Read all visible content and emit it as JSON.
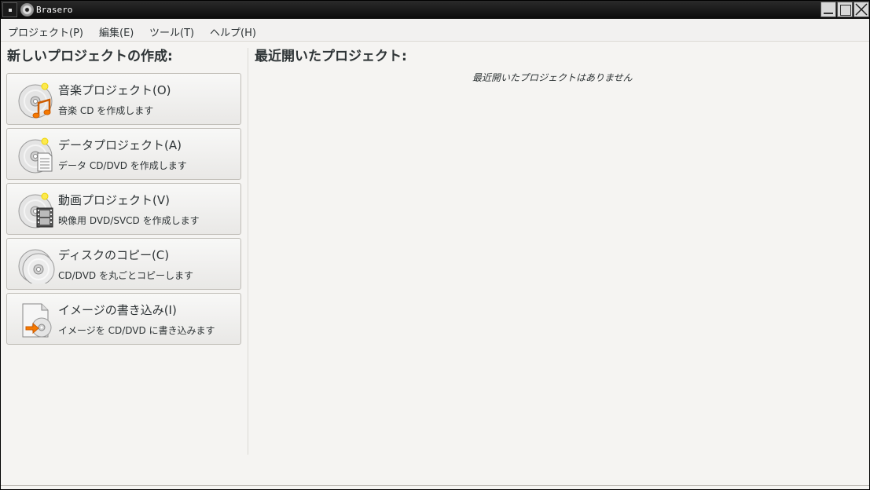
{
  "window": {
    "title": "Brasero"
  },
  "menubar": {
    "items": [
      {
        "label": "プロジェクト(P)"
      },
      {
        "label": "編集(E)"
      },
      {
        "label": "ツール(T)"
      },
      {
        "label": "ヘルプ(H)"
      }
    ]
  },
  "new_project": {
    "title": "新しいプロジェクトの作成:",
    "buttons": [
      {
        "label": "音楽プロジェクト(O)",
        "desc": "音楽  CD を作成します",
        "icon": "audio-cd-icon"
      },
      {
        "label": "データプロジェクト(A)",
        "desc": "データ  CD/DVD を作成します",
        "icon": "data-cd-icon"
      },
      {
        "label": "動画プロジェクト(V)",
        "desc": "映像用  DVD/SVCD を作成します",
        "icon": "video-cd-icon"
      },
      {
        "label": "ディスクのコピー(C)",
        "desc": "CD/DVD を丸ごとコピーします",
        "icon": "disc-copy-icon"
      },
      {
        "label": "イメージの書き込み(I)",
        "desc": "イメージを  CD/DVD に書き込みます",
        "icon": "image-burn-icon"
      }
    ]
  },
  "recent": {
    "title": "最近開いたプロジェクト:",
    "empty_text": "最近開いたプロジェクトはありません"
  }
}
